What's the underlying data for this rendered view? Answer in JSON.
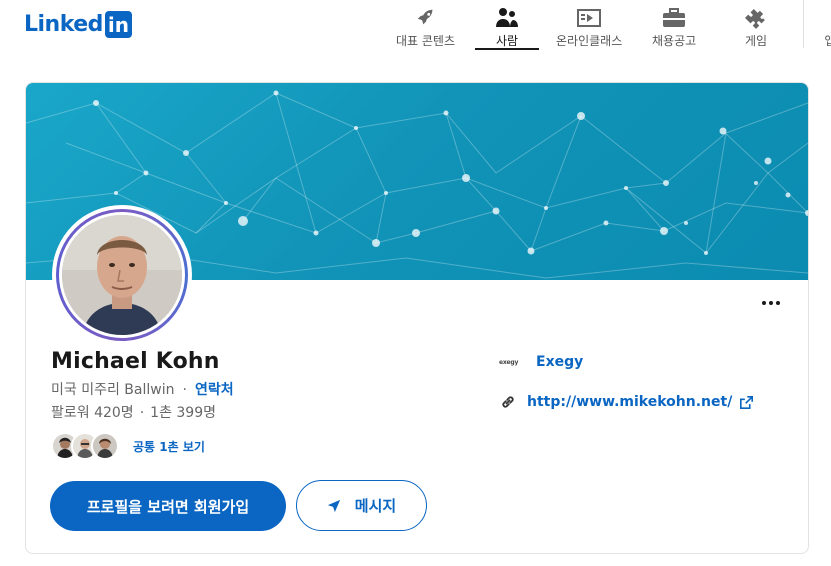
{
  "brand": {
    "logo_text": "Linked",
    "logo_box": "in",
    "color": "#0a66c2"
  },
  "nav": {
    "items": [
      {
        "label": "대표 콘텐츠",
        "icon": "rocket-icon",
        "active": false
      },
      {
        "label": "사람",
        "icon": "people-icon",
        "active": true
      },
      {
        "label": "온라인클래스",
        "icon": "video-player-icon",
        "active": false
      },
      {
        "label": "채용공고",
        "icon": "briefcase-icon",
        "active": false
      },
      {
        "label": "게임",
        "icon": "puzzle-icon",
        "active": false
      },
      {
        "label": "앱",
        "icon": "apps-icon",
        "active": false
      }
    ]
  },
  "profile": {
    "name": "Michael Kohn",
    "location": "미국 미주리 Ballwin",
    "separator": "·",
    "contact_label": "연락처",
    "followers": "팔로워 420명",
    "connections": "1촌 399명",
    "mutual_label": "공통 1촌 보기",
    "primary_button": "프로필을 보려면 회원가입",
    "message_button": "메시지",
    "more_icon": "more-horizontal-icon"
  },
  "sidebar_info": {
    "company_logo_text": "exegy",
    "company_name": "Exegy",
    "website": "http://www.mikekohn.net/",
    "link_icon": "link-icon",
    "external_icon": "external-link-icon"
  },
  "colors": {
    "accent": "#0a66c2",
    "banner": "#1aa7c9",
    "text_primary": "#191919",
    "text_secondary": "#666666"
  }
}
